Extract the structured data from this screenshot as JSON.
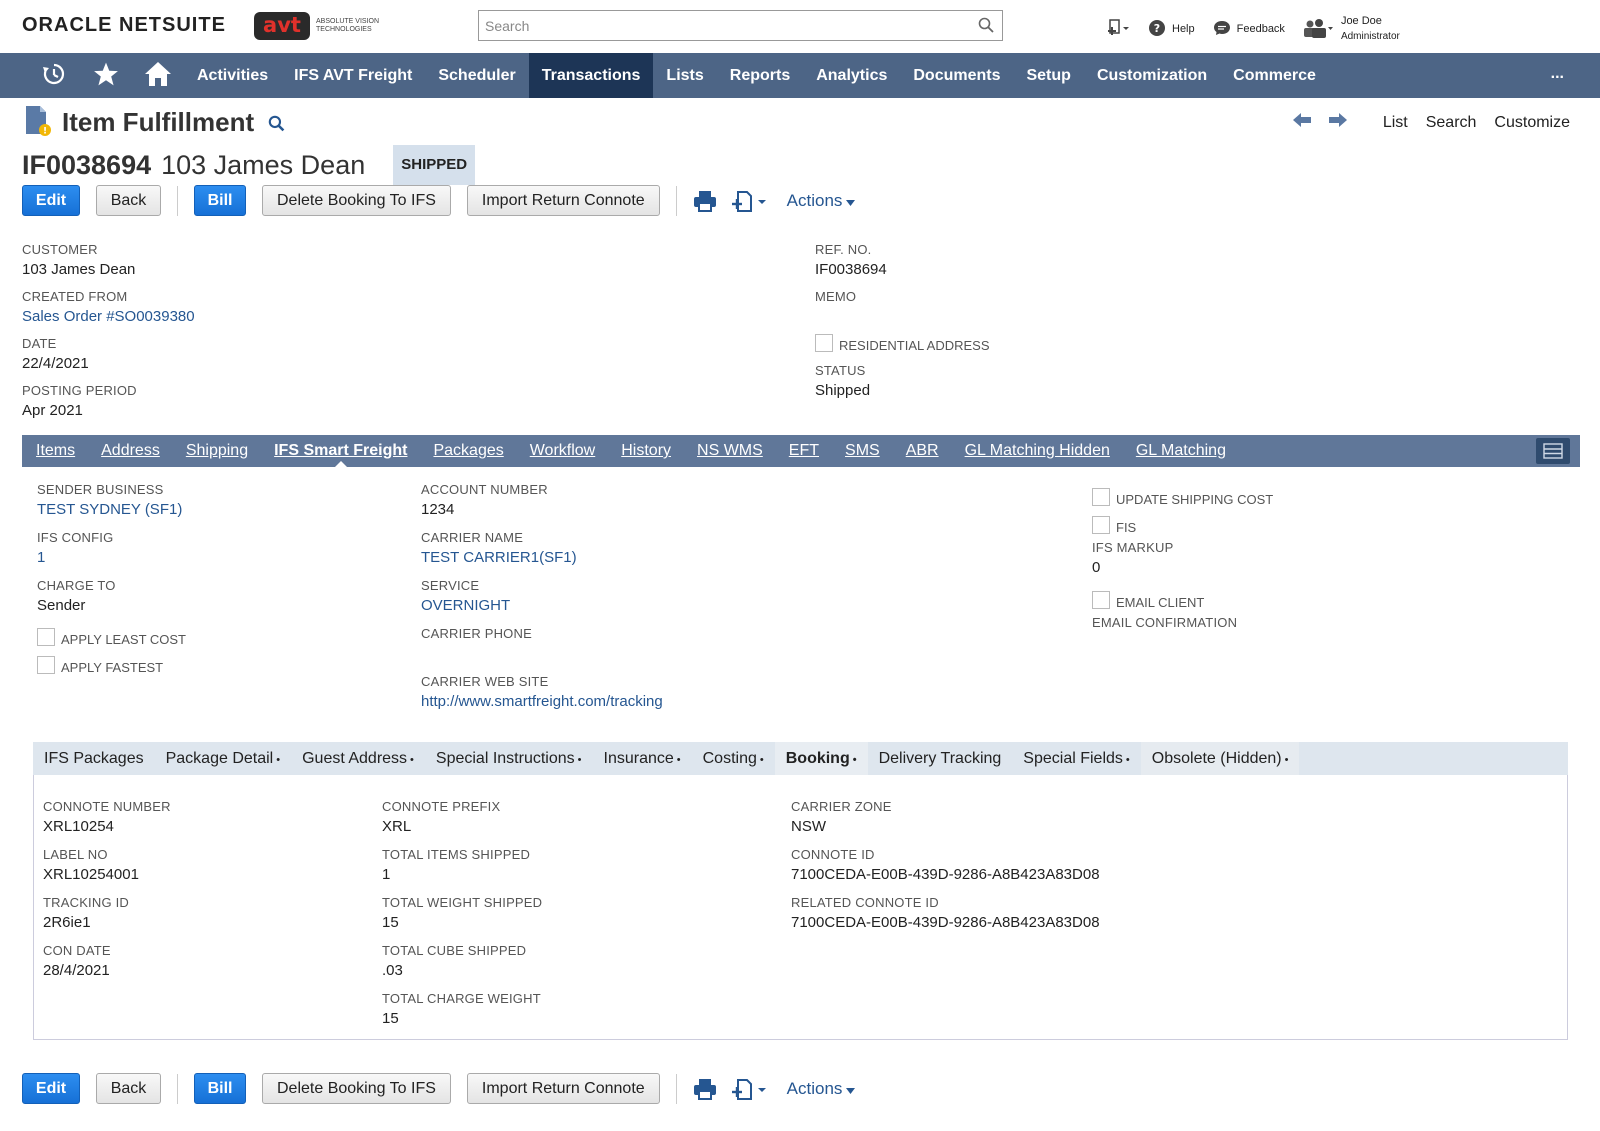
{
  "header": {
    "brand_prefix": "ORACLE",
    "brand_suffix": "NETSUITE",
    "partner_logo": "avt",
    "partner_tagline": "ABSOLUTE VISION TECHNOLOGIES",
    "search_placeholder": "Search",
    "help_label": "Help",
    "feedback_label": "Feedback",
    "user_name": "Joe Doe",
    "user_role": "Administrator"
  },
  "nav": {
    "items": [
      "Activities",
      "IFS AVT Freight",
      "Scheduler",
      "Transactions",
      "Lists",
      "Reports",
      "Analytics",
      "Documents",
      "Setup",
      "Customization",
      "Commerce"
    ],
    "active": "Transactions",
    "more": "..."
  },
  "page": {
    "title": "Item Fulfillment",
    "record_id": "IF0038694",
    "record_name": "103 James Dean",
    "status_badge": "SHIPPED",
    "links": [
      "List",
      "Search",
      "Customize"
    ]
  },
  "buttons": {
    "edit": "Edit",
    "back": "Back",
    "bill": "Bill",
    "delete_booking": "Delete Booking To IFS",
    "import_return": "Import Return Connote",
    "actions": "Actions"
  },
  "main_fields": {
    "customer": {
      "label": "CUSTOMER",
      "value": "103 James Dean"
    },
    "created_from": {
      "label": "CREATED FROM",
      "value": "Sales Order #SO0039380"
    },
    "date": {
      "label": "DATE",
      "value": "22/4/2021"
    },
    "posting_period": {
      "label": "POSTING PERIOD",
      "value": "Apr 2021"
    },
    "ref_no": {
      "label": "REF. NO.",
      "value": "IF0038694"
    },
    "memo": {
      "label": "MEMO",
      "value": ""
    },
    "residential_address": {
      "label": "RESIDENTIAL ADDRESS"
    },
    "status": {
      "label": "STATUS",
      "value": "Shipped"
    }
  },
  "subtabs": {
    "items": [
      "Items",
      "Address",
      "Shipping",
      "IFS Smart Freight",
      "Packages",
      "Workflow",
      "History",
      "NS WMS",
      "EFT",
      "SMS",
      "ABR",
      "GL Matching Hidden",
      "GL Matching"
    ],
    "active": "IFS Smart Freight"
  },
  "freight_fields": {
    "sender_business": {
      "label": "SENDER BUSINESS",
      "value": "TEST SYDNEY (SF1)"
    },
    "ifs_config": {
      "label": "IFS CONFIG",
      "value": "1"
    },
    "charge_to": {
      "label": "CHARGE TO",
      "value": "Sender"
    },
    "apply_least_cost": {
      "label": "APPLY LEAST COST"
    },
    "apply_fastest": {
      "label": "APPLY FASTEST"
    },
    "account_number": {
      "label": "ACCOUNT NUMBER",
      "value": "1234"
    },
    "carrier_name": {
      "label": "CARRIER NAME",
      "value": "TEST CARRIER1(SF1)"
    },
    "service": {
      "label": "SERVICE",
      "value": "OVERNIGHT"
    },
    "carrier_phone": {
      "label": "CARRIER PHONE",
      "value": ""
    },
    "carrier_web_site": {
      "label": "CARRIER WEB SITE",
      "value": "http://www.smartfreight.com/tracking"
    },
    "update_shipping_cost": {
      "label": "UPDATE SHIPPING COST"
    },
    "fis": {
      "label": "FIS"
    },
    "ifs_markup": {
      "label": "IFS MARKUP",
      "value": "0"
    },
    "email_client": {
      "label": "EMAIL CLIENT"
    },
    "email_confirmation": {
      "label": "EMAIL CONFIRMATION",
      "value": ""
    }
  },
  "inner_tabs": {
    "items": [
      {
        "label": "IFS Packages",
        "dot": false
      },
      {
        "label": "Package Detail",
        "dot": true
      },
      {
        "label": "Guest Address",
        "dot": true
      },
      {
        "label": "Special Instructions",
        "dot": true
      },
      {
        "label": "Insurance",
        "dot": true
      },
      {
        "label": "Costing",
        "dot": true
      },
      {
        "label": "Booking",
        "dot": true
      },
      {
        "label": "Delivery Tracking",
        "dot": false
      },
      {
        "label": "Special Fields",
        "dot": true
      },
      {
        "label": "Obsolete (Hidden)",
        "dot": true
      }
    ],
    "active": "Booking",
    "dot_char": "•"
  },
  "booking_fields": {
    "connote_number": {
      "label": "CONNOTE NUMBER",
      "value": "XRL10254"
    },
    "label_no": {
      "label": "LABEL NO",
      "value": "XRL10254001"
    },
    "tracking_id": {
      "label": "TRACKING ID",
      "value": "2R6ie1"
    },
    "con_date": {
      "label": "CON DATE",
      "value": "28/4/2021"
    },
    "connote_prefix": {
      "label": "CONNOTE PREFIX",
      "value": "XRL"
    },
    "total_items_shipped": {
      "label": "TOTAL ITEMS SHIPPED",
      "value": "1"
    },
    "total_weight_shipped": {
      "label": "TOTAL WEIGHT SHIPPED",
      "value": "15"
    },
    "total_cube_shipped": {
      "label": "TOTAL CUBE SHIPPED",
      "value": ".03"
    },
    "total_charge_weight": {
      "label": "TOTAL CHARGE WEIGHT",
      "value": "15"
    },
    "carrier_zone": {
      "label": "CARRIER ZONE",
      "value": "NSW"
    },
    "connote_id": {
      "label": "CONNOTE ID",
      "value": "7100CEDA-E00B-439D-9286-A8B423A83D08"
    },
    "related_connote_id": {
      "label": "RELATED CONNOTE ID",
      "value": "7100CEDA-E00B-439D-9286-A8B423A83D08"
    }
  },
  "colors": {
    "nav_bg": "#4d6586",
    "nav_active": "#1d3556",
    "primary_button": "#1670d6",
    "link": "#255691",
    "subtab_bg": "#607799"
  }
}
